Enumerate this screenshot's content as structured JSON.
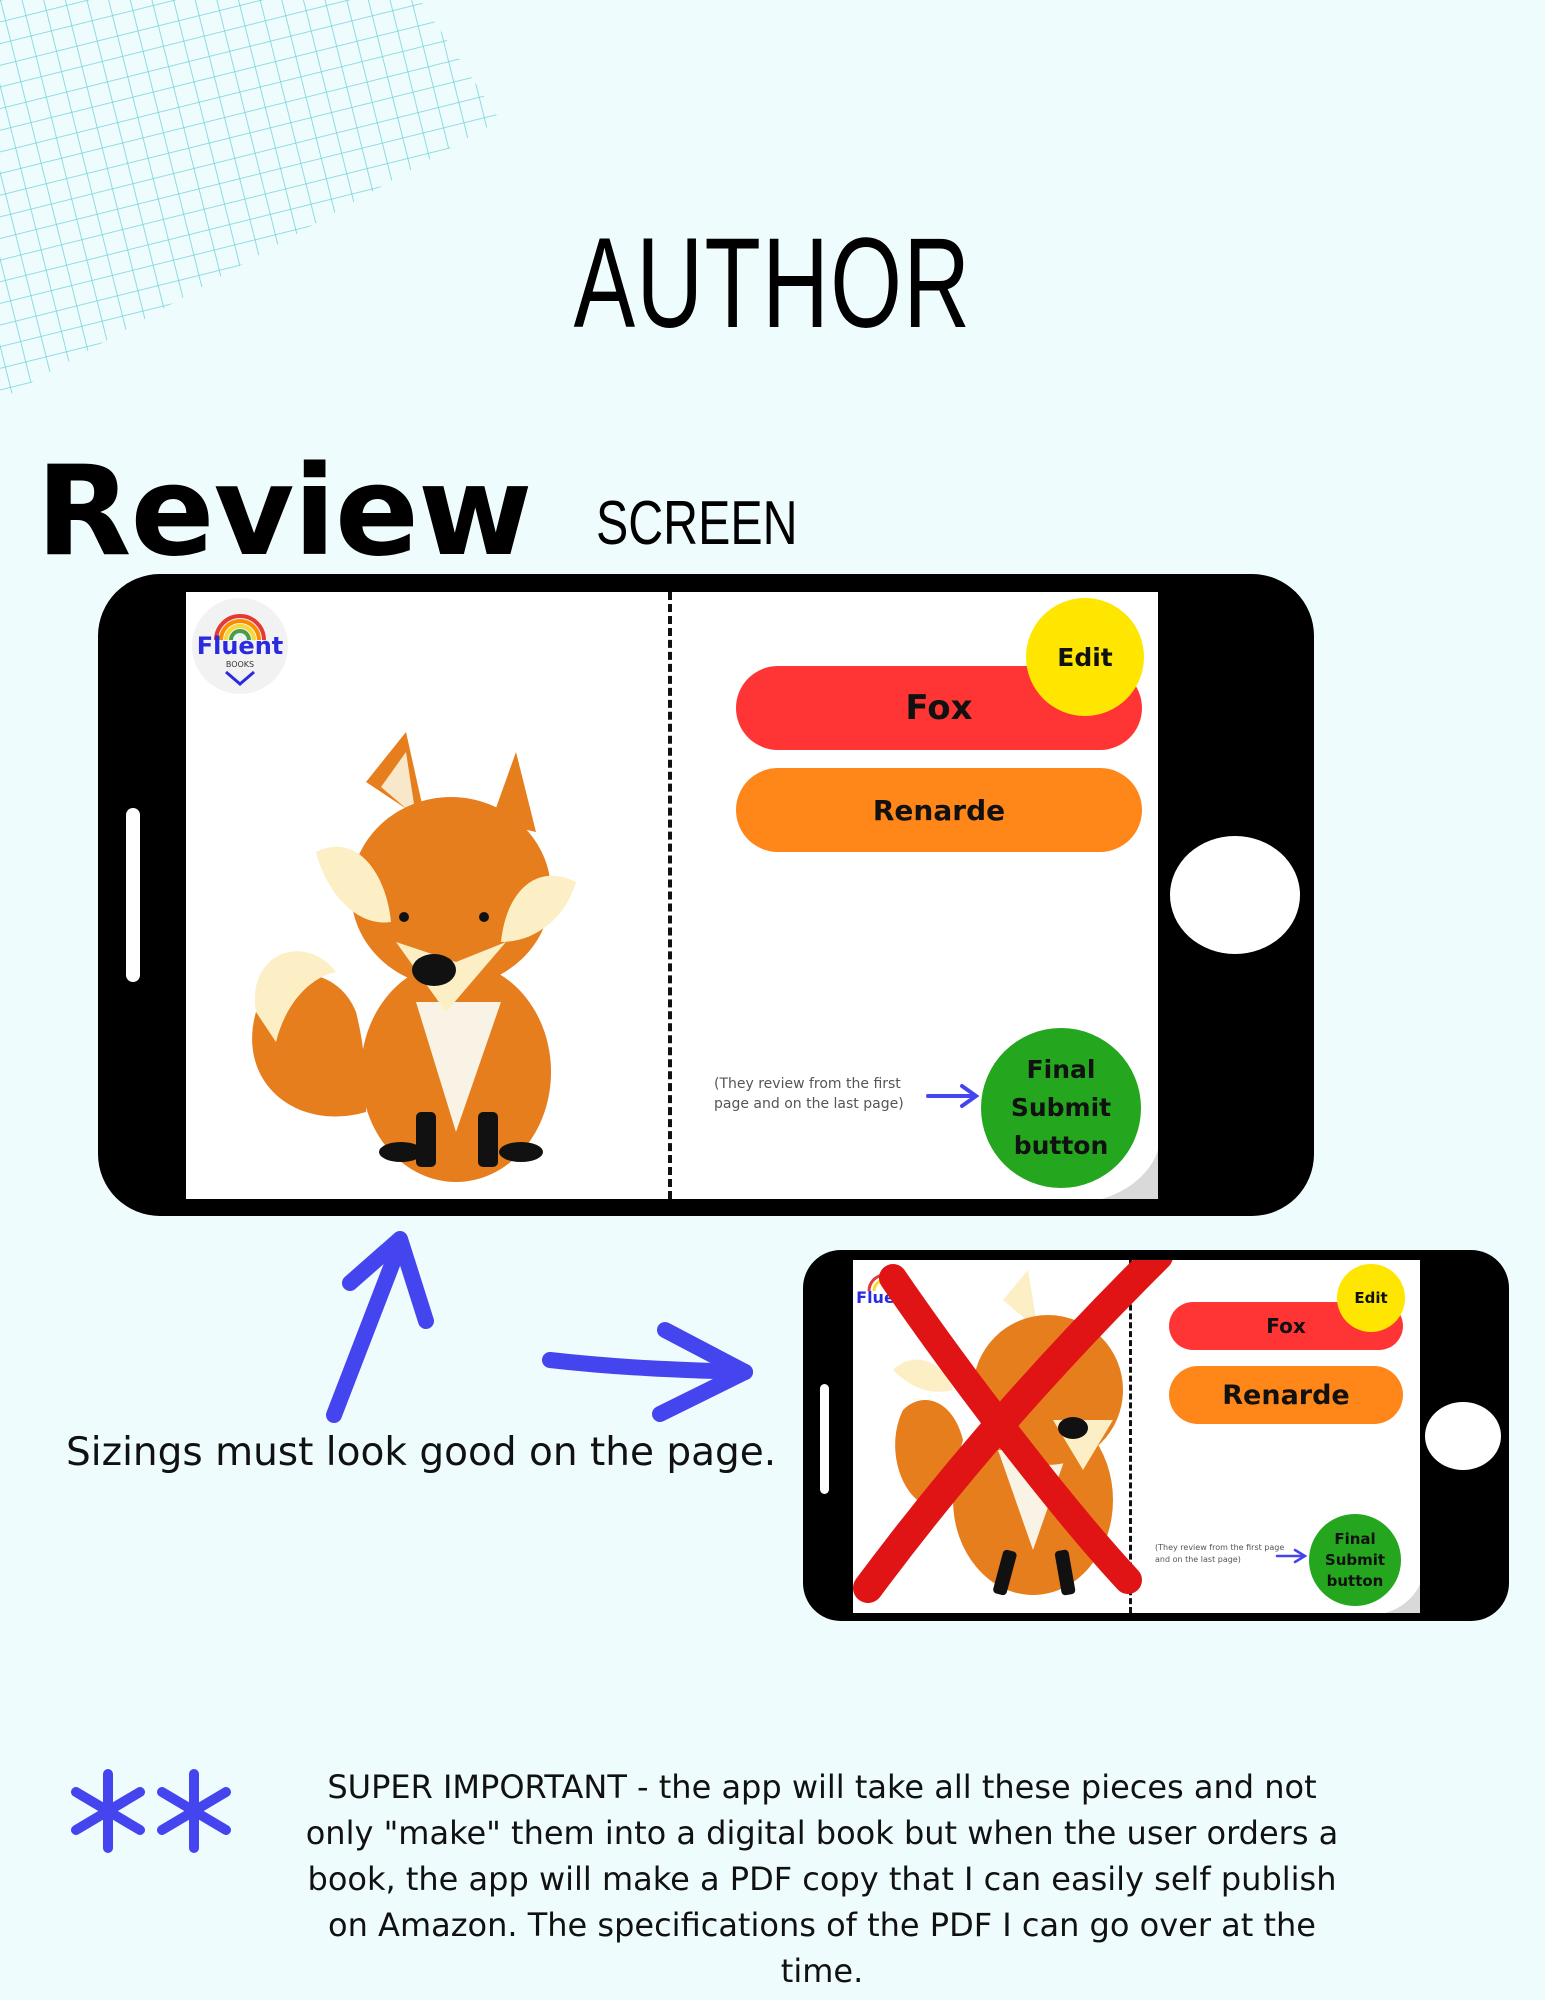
{
  "page": {
    "title": "AUTHOR",
    "heading_bold": "Review",
    "heading_light": "SCREEN",
    "caption": "Sizings must look good on the page.",
    "footnote": "SUPER IMPORTANT - the app will take all these pieces and not only \"make\" them into a digital book but when the user orders a book, the app will make a PDF copy that I can easily self publish on Amazon. The specifications of the PDF I can go over at the time."
  },
  "logo": {
    "brand": "Fluent",
    "sub": "BOOKS"
  },
  "mockup_main": {
    "word_primary": "Fox",
    "word_secondary": "Renarde",
    "edit_label": "Edit",
    "submit_label": "Final Submit button",
    "note": "(They review from the first page and on the last page)"
  },
  "mockup_small": {
    "word_primary": "Fox",
    "word_secondary": "Renarde",
    "edit_label": "Edit",
    "submit_label": "Final Submit button",
    "note": "(They review from the first page and on the last page)"
  },
  "colors": {
    "background": "#effcfd",
    "grid": "#74d3dc",
    "word_primary_bg": "#ff3535",
    "word_secondary_bg": "#ff8618",
    "edit_bg": "#ffe600",
    "submit_bg": "#24a61e",
    "arrow": "#4545f0",
    "cross": "#e01414",
    "fox_orange": "#e67e1d"
  },
  "icons": [
    "grid-decoration",
    "fluent-books-logo",
    "fox-illustration",
    "arrow-icon",
    "cross-mark-icon",
    "asterisk-icon"
  ]
}
